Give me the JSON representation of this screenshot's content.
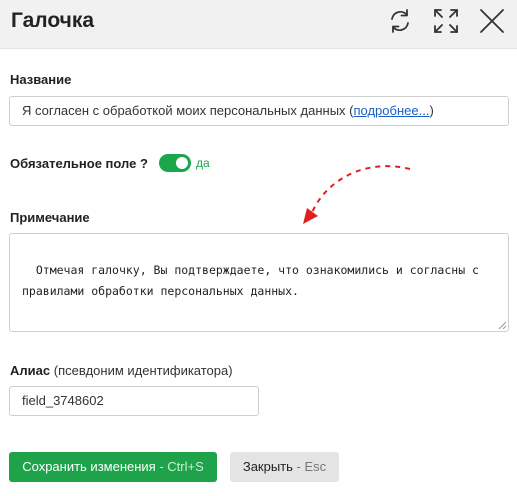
{
  "dialog": {
    "title": "Галочка",
    "actions": {
      "refresh_icon": "refresh-icon",
      "expand_icon": "expand-icon",
      "close_icon": "close-icon"
    }
  },
  "name_field": {
    "label": "Название",
    "value_text": "Я согласен с обработкой моих персональных данных (",
    "link_text": "подробнее...",
    "value_suffix": ")"
  },
  "required_field": {
    "label": "Обязательное поле ?",
    "toggle_state": true,
    "toggle_text": "да",
    "accent": "#1aa64a"
  },
  "note_field": {
    "label": "Примечание",
    "value": "Отмечая галочку, Вы подтверждаете, что ознакомились и согласны с правилами обработки персональных данных."
  },
  "alias_field": {
    "label": "Алиас",
    "label_hint": "(псевдоним идентификатора)",
    "value": "field_3748602"
  },
  "buttons": {
    "save_label": "Сохранить изменения",
    "save_hint": " - Ctrl+S",
    "close_label": "Закрыть",
    "close_hint": " - Esc"
  },
  "colors": {
    "save_button": "#1ea24a",
    "arrow": "#e02020",
    "link": "#1a5fc4"
  }
}
